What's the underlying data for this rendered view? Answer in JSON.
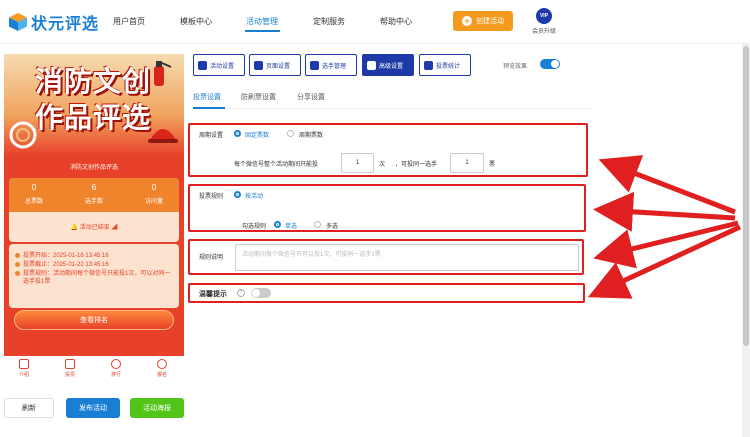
{
  "header": {
    "logo_text": "状元评选",
    "nav": [
      "用户首页",
      "模板中心",
      "活动管理",
      "定制服务",
      "帮助中心"
    ],
    "active_nav": "活动管理",
    "create_button": "创建活动",
    "vip_badge": "VIP",
    "vip_label": "会员升级"
  },
  "preview": {
    "poster_title_line1": "消防文创",
    "poster_title_line2": "作品评选",
    "subtitle": "消防文创作品评选",
    "stats": [
      {
        "value": "0",
        "label": "总票数"
      },
      {
        "value": "6",
        "label": "选手数"
      },
      {
        "value": "0",
        "label": "访问量"
      }
    ],
    "ended_text": "活动已结束",
    "info": [
      "投票开始：2025-01-16 13:45:16",
      "投票截止：2025-01-22 13:45:16",
      "投票规则：活动期间每个微信号只能投1次，可以对同一选手投1票"
    ],
    "rank_button": "查看排名",
    "tabbar": [
      "介绍",
      "投票",
      "排行",
      "报名"
    ]
  },
  "bottom_buttons": {
    "refresh": "刷新",
    "publish": "发布活动",
    "poster": "活动海报"
  },
  "toolbar": {
    "buttons": [
      "活动设置",
      "页面设置",
      "选手管理",
      "高级设置",
      "投票统计"
    ],
    "active": "高级设置",
    "preview_label": "预览效果"
  },
  "subtabs": [
    "投票设置",
    "防刷票设置",
    "分享设置"
  ],
  "active_subtab": "投票设置",
  "settings": {
    "cycle": {
      "label": "周期设置",
      "options": [
        "固定票数",
        "周期票数"
      ],
      "selected": "固定票数",
      "text1": "每个微信号整个活动期间只能投",
      "value1": "1",
      "unit1": "次",
      "text2": "，可投同一选手",
      "value2": "1",
      "unit2": "票"
    },
    "vote_rule": {
      "label": "投票规则",
      "option": "按活动",
      "check_label": "勾选规则",
      "check_options": [
        "单选",
        "多选"
      ],
      "check_selected": "单选"
    },
    "rule_desc": {
      "label": "规则说明",
      "placeholder": "活动期间每个微信号只可以投1次，可投同一选手1票"
    },
    "tip": {
      "label": "温馨提示",
      "help_icon": "?"
    }
  },
  "colors": {
    "brand_blue": "#1a7fd4",
    "dark_blue": "#1e3aa8",
    "orange": "#f39a1f",
    "red_annotation": "#e02020",
    "green": "#52c41a"
  }
}
